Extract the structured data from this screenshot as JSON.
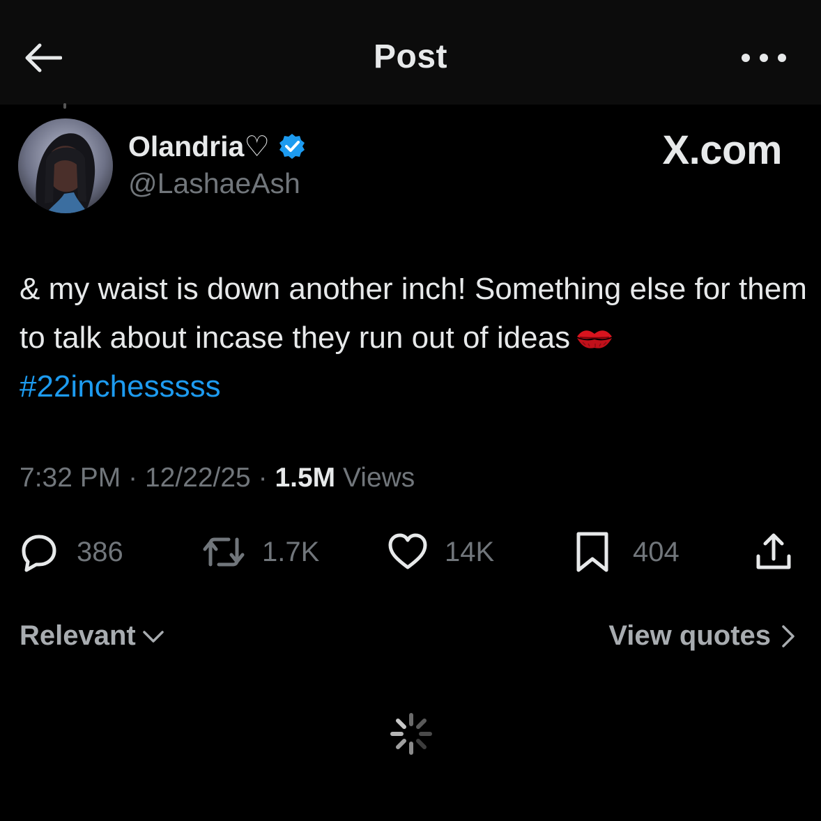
{
  "header": {
    "title": "Post",
    "back_icon": "arrow-left-icon",
    "more_icon": "more-horizontal-icon"
  },
  "author": {
    "display_name": "Olandria♡",
    "handle": "@LashaeAsh",
    "verified": true,
    "verified_color": "#1d9bf0"
  },
  "brand": {
    "label": "X.com"
  },
  "post": {
    "text_line": "& my waist is down another inch! Something else for them to talk about incase they run out of ideas",
    "emoji": "kiss-mark-emoji",
    "hashtag": "#22inchesssss",
    "hashtag_color": "#1d9bf0"
  },
  "meta": {
    "time": "7:32 PM",
    "separator": "·",
    "date": "12/22/25",
    "views_count": "1.5M",
    "views_label": "Views"
  },
  "actions": {
    "replies": "386",
    "reposts": "1.7K",
    "likes": "14K",
    "bookmarks": "404",
    "share_icon": "share-icon"
  },
  "sort": {
    "relevant_label": "Relevant",
    "view_quotes_label": "View quotes"
  },
  "colors": {
    "background": "#000000",
    "topbar": "#0c0c0c",
    "text_primary": "#e7e9ea",
    "text_secondary": "#71767b",
    "accent": "#1d9bf0"
  }
}
